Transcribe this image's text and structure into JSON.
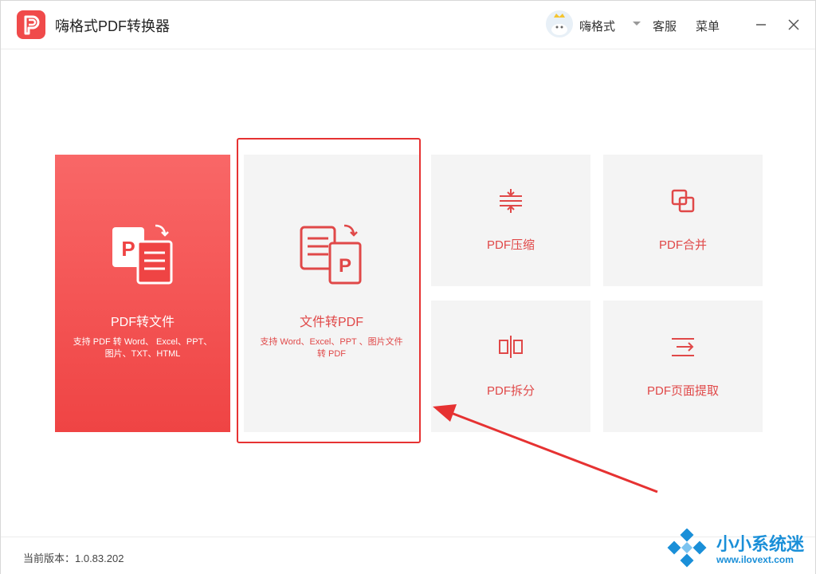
{
  "window": {
    "title": "嗨格式PDF转换器",
    "user_name": "嗨格式",
    "support_label": "客服",
    "menu_label": "菜单"
  },
  "tiles": {
    "pdf_to_file": {
      "title": "PDF转文件",
      "desc": "支持 PDF 转 Word、 Excel、PPT、图片、TXT、HTML"
    },
    "file_to_pdf": {
      "title": "文件转PDF",
      "desc": "支持 Word、Excel、PPT 、图片文件转 PDF"
    },
    "compress": {
      "title": "PDF压缩"
    },
    "merge": {
      "title": "PDF合并"
    },
    "split": {
      "title": "PDF拆分"
    },
    "extract": {
      "title": "PDF页面提取"
    }
  },
  "footer": {
    "version": "当前版本：1.0.83.202"
  },
  "watermark": {
    "name": "小小系统迷",
    "url": "www.ilovext.com"
  },
  "colors": {
    "accent": "#ef4444",
    "tile_bg": "#f4f4f4",
    "highlight": "#e63232",
    "watermark": "#1a8fd8"
  },
  "icons": {
    "app": "pdf-logo-icon",
    "user_caret": "caret-down-icon",
    "minimize": "minimize-icon",
    "close": "close-icon",
    "pdf_to_file": "pdf-to-document-icon",
    "file_to_pdf": "document-to-pdf-icon",
    "compress": "compress-icon",
    "merge": "merge-icon",
    "split": "split-icon",
    "extract": "page-extract-icon"
  }
}
